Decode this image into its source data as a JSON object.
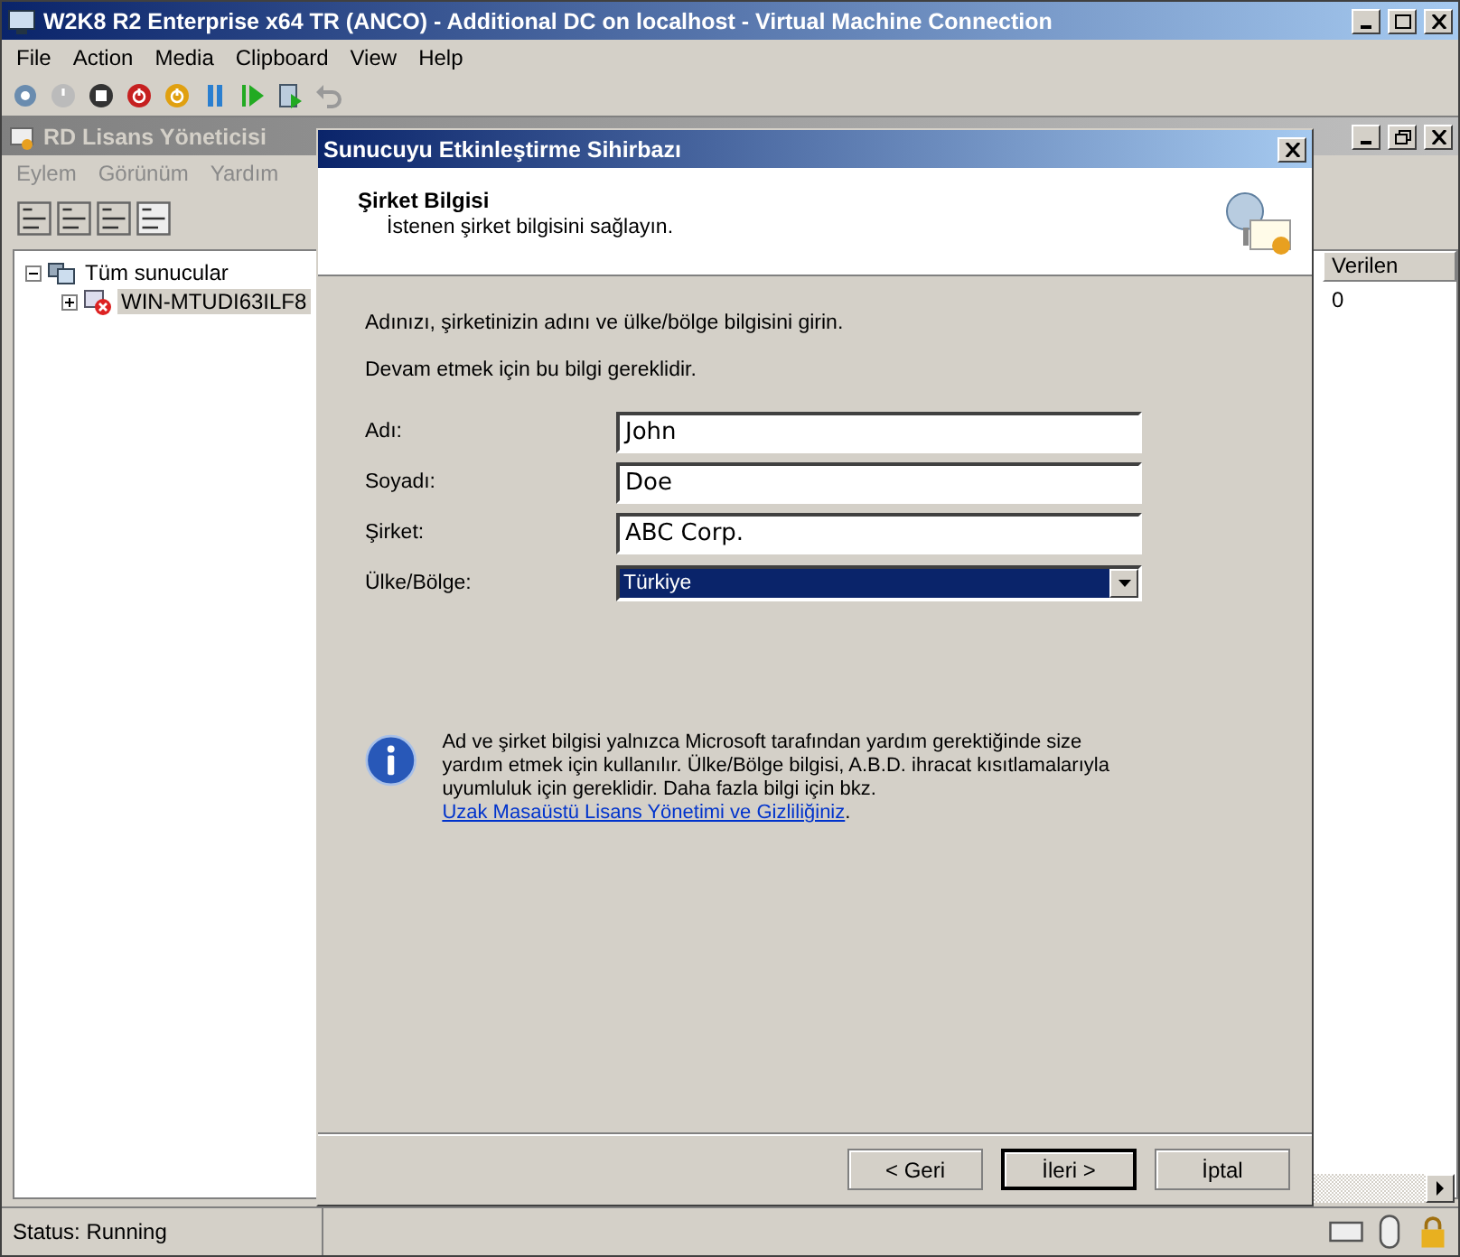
{
  "vm_window": {
    "title": "W2K8 R2 Enterprise x64 TR (ANCO) - Additional DC on localhost - Virtual Machine Connection",
    "menu": [
      "File",
      "Action",
      "Media",
      "Clipboard",
      "View",
      "Help"
    ],
    "status": "Status: Running"
  },
  "app": {
    "title": "RD Lisans Yöneticisi",
    "menu": [
      "Eylem",
      "Görünüm",
      "Yardım"
    ],
    "tree": [
      {
        "label": "Tüm sunucular",
        "expanded": true,
        "children": [
          {
            "label": "WIN-MTUDI63ILF8",
            "expanded": false
          }
        ]
      }
    ],
    "list": {
      "column": "Verilen",
      "cell": "0"
    }
  },
  "dialog": {
    "title": "Sunucuyu Etkinleştirme Sihirbazı",
    "heading": "Şirket Bilgisi",
    "subheading": "İstenen şirket bilgisini sağlayın.",
    "intro": [
      "Adınızı, şirketinizin adını ve ülke/bölge bilgisini girin.",
      "Devam etmek için bu bilgi gereklidir."
    ],
    "fields": [
      {
        "label": "Adı:",
        "value": "John",
        "kind": "text"
      },
      {
        "label": "Soyadı:",
        "value": "Doe",
        "kind": "text"
      },
      {
        "label": "Şirket:",
        "value": "ABC Corp.",
        "kind": "text"
      },
      {
        "label": "Ülke/Bölge:",
        "value": "Türkiye",
        "kind": "dropdown"
      }
    ],
    "info": {
      "text": "Ad ve şirket bilgisi yalnızca Microsoft tarafından yardım gerektiğinde size yardım etmek için kullanılır. Ülke/Bölge bilgisi, A.B.D. ihracat kısıtlamalarıyla uyumluluk için gereklidir. Daha fazla bilgi için bkz. ",
      "link": "Uzak Masaüstü Lisans Yönetimi ve Gizliliğiniz",
      "suffix": "."
    },
    "buttons": [
      {
        "label": "< Geri",
        "default": false
      },
      {
        "label": "İleri >",
        "default": true
      },
      {
        "label": "İptal",
        "default": false
      }
    ]
  }
}
